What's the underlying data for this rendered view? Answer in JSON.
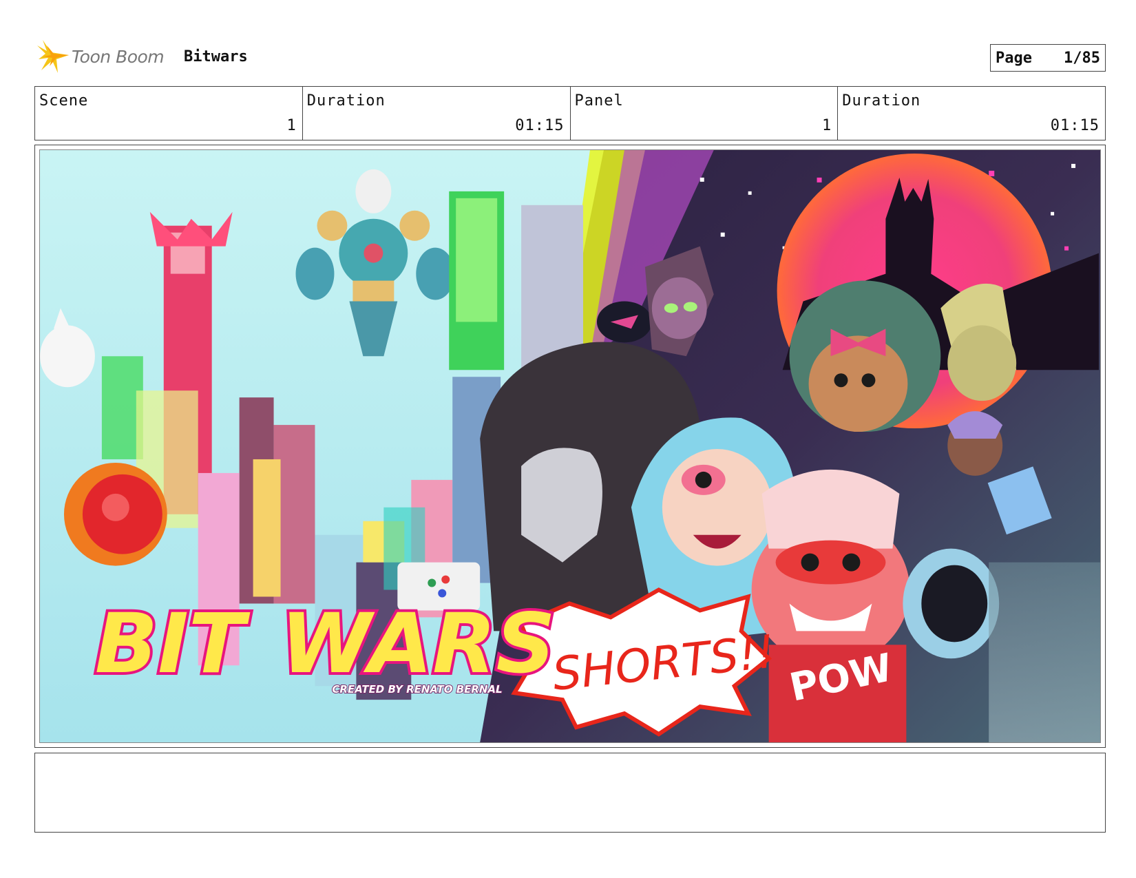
{
  "header": {
    "logo_text": "Toon Boom",
    "project_title": "Bitwars",
    "page_label": "Page",
    "page_value": "1/85"
  },
  "info": [
    {
      "label": "Scene",
      "value": "1"
    },
    {
      "label": "Duration",
      "value": "01:15"
    },
    {
      "label": "Panel",
      "value": "1"
    },
    {
      "label": "Duration",
      "value": "01:15"
    }
  ],
  "panel_art": {
    "title_bit": "BIT",
    "title_wars": "WARS",
    "title_shorts": "SHORTS!!",
    "credit": "CREATED BY RENATO BERNAL",
    "shirt_text": "POW"
  },
  "colors": {
    "logo_yellow": "#f5c518",
    "title_yellow": "#ffe84a",
    "title_magenta": "#e8157e",
    "shorts_red": "#e8261b"
  }
}
